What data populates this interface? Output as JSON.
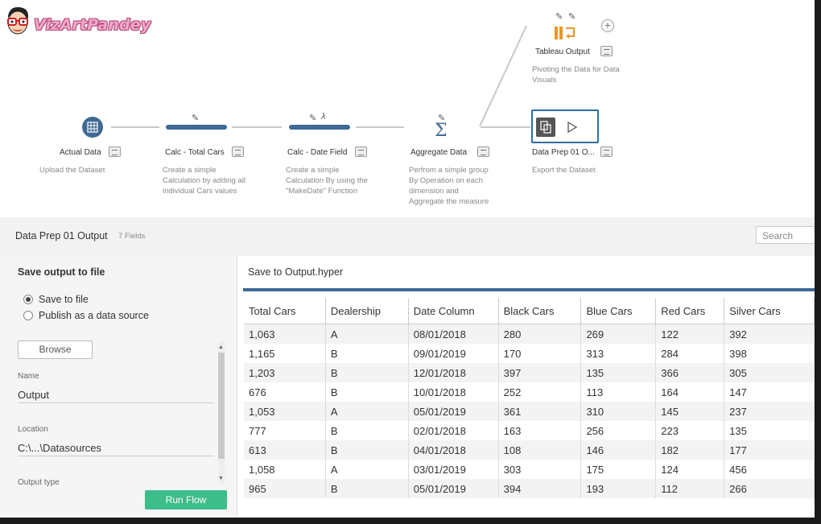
{
  "logo": {
    "text": "VizArtPandey"
  },
  "flow": {
    "nodes": [
      {
        "label": "Actual Data",
        "description": "Upload the Dataset"
      },
      {
        "label": "Calc - Total Cars",
        "description": "Create a simple Calculation by adding all individual Cars values"
      },
      {
        "label": "Calc - Date Field",
        "description": "Create a simple Calculation By using the \"MakeDate\" Function"
      },
      {
        "label": "Aggregate Data",
        "description": "Perfrom a simple group By Operation on each dimension and Aggregate the measure"
      },
      {
        "label": "Data Prep 01 O...",
        "description": "Export the Dataset"
      },
      {
        "label": "Tableau Output",
        "description": "Pivoting the Data for Data Visuals"
      }
    ]
  },
  "panel": {
    "title": "Data Prep 01 Output",
    "fields_count": "7 Fields",
    "search_placeholder": "Search"
  },
  "settings": {
    "heading": "Save output to file",
    "options": [
      "Save to file",
      "Publish as a data source"
    ],
    "selected_option": "Save to file",
    "browse_label": "Browse",
    "name_label": "Name",
    "name_value": "Output",
    "location_label": "Location",
    "location_value": "C:\\...\\Datasources",
    "output_type_label": "Output type",
    "run_label": "Run Flow"
  },
  "preview": {
    "title": "Save to Output.hyper",
    "columns": [
      "Total Cars",
      "Dealership",
      "Date Column",
      "Black Cars",
      "Blue Cars",
      "Red Cars",
      "Silver Cars"
    ],
    "rows": [
      [
        "1,063",
        "A",
        "08/01/2018",
        "280",
        "269",
        "122",
        "392"
      ],
      [
        "1,165",
        "B",
        "09/01/2019",
        "170",
        "313",
        "284",
        "398"
      ],
      [
        "1,203",
        "B",
        "12/01/2018",
        "397",
        "135",
        "366",
        "305"
      ],
      [
        "676",
        "B",
        "10/01/2018",
        "252",
        "113",
        "164",
        "147"
      ],
      [
        "1,053",
        "A",
        "05/01/2019",
        "361",
        "310",
        "145",
        "237"
      ],
      [
        "777",
        "B",
        "02/01/2018",
        "163",
        "256",
        "223",
        "135"
      ],
      [
        "613",
        "B",
        "04/01/2018",
        "108",
        "146",
        "182",
        "177"
      ],
      [
        "1,058",
        "A",
        "03/01/2019",
        "303",
        "175",
        "124",
        "456"
      ],
      [
        "965",
        "B",
        "05/01/2019",
        "394",
        "193",
        "112",
        "266"
      ]
    ]
  },
  "colors": {
    "accent": "#3e6a93",
    "run_button": "#3dbd8a",
    "selected_border": "#2e6da4"
  }
}
